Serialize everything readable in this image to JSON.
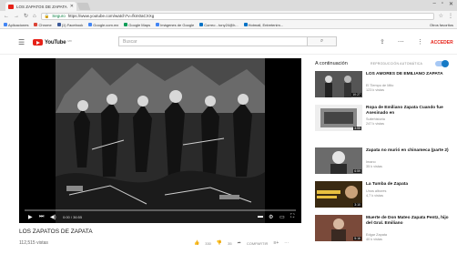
{
  "browser": {
    "tab_title": "LOS ZAPATOS DE ZAPATA",
    "tab_close": "✕",
    "url_secure_label": "Seguro",
    "url": "https://www.youtube.com/watch?v=fkm0aCXXg",
    "bookmarks": [
      {
        "label": "Aplicaciones",
        "color": "#4285f4"
      },
      {
        "label": "Chrome",
        "color": "#db4437"
      },
      {
        "label": "(1) Facebook",
        "color": "#3b5998"
      },
      {
        "label": "Google.com.mx",
        "color": "#4285f4"
      },
      {
        "label": "Google Maps",
        "color": "#0f9d58"
      },
      {
        "label": "Imágenes de Google",
        "color": "#4285f4"
      },
      {
        "label": "Correo - tony24@h...",
        "color": "#0072c6"
      },
      {
        "label": "Hotmail, Entretenim...",
        "color": "#0072c6"
      }
    ],
    "other_bookmarks": "Otros favoritos"
  },
  "youtube": {
    "logo_text": "YouTube",
    "logo_region": "MX",
    "search_placeholder": "Buscar",
    "signin_label": "ACCEDER",
    "accent": "#e62117"
  },
  "player": {
    "time": "0:00 / 36:55",
    "progress_fraction": 0.0
  },
  "video": {
    "title": "LOS ZAPATOS DE ZAPATA",
    "views": "112,515 vistas",
    "likes": "330",
    "dislikes": "35",
    "share_label": "COMPARTIR"
  },
  "sidebar": {
    "up_next_label": "A continuación",
    "autoplay_label": "REPRODUCCIÓN AUTOMÁTICA",
    "recommendations": [
      {
        "title": "LOS AMORES DE EMILIANO ZAPATA",
        "channel": "El Tiempo de Mito",
        "views": "123 k vistas",
        "duration": "10:27"
      },
      {
        "title": "Ropa de Emiliano Zapata Cuando fue Asesinado en",
        "channel": "Suitehistoria",
        "views": "247 k vistas",
        "duration": "3:55"
      },
      {
        "title": "Zapata no murió en chinameca (parte 2)",
        "channel": "Imano",
        "views": "35 k vistas",
        "duration": "6:59"
      },
      {
        "title": "La Tumba de Zapata",
        "channel": "Unos albores",
        "views": "4,7 k vistas",
        "duration": "3:10"
      },
      {
        "title": "Muerte de Don Mateo Zapata Pentz, hijo del Gral. Emiliano",
        "channel": "Edgar Zapata",
        "views": "40 k vistas",
        "duration": "5:16"
      }
    ]
  }
}
